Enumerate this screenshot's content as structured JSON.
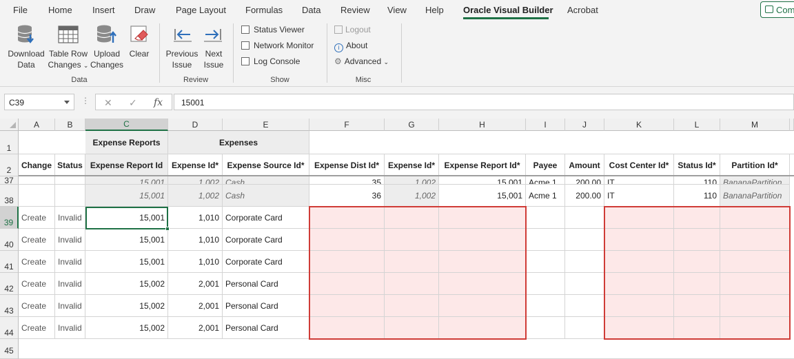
{
  "menu": {
    "items": [
      "File",
      "Home",
      "Insert",
      "Draw",
      "Page Layout",
      "Formulas",
      "Data",
      "Review",
      "View",
      "Help",
      "Oracle Visual Builder",
      "Acrobat"
    ],
    "comments_label": "Com"
  },
  "ribbon": {
    "data_group": {
      "label": "Data",
      "download": [
        "Download",
        "Data"
      ],
      "table_row_changes": [
        "Table Row",
        "Changes"
      ],
      "upload": [
        "Upload",
        "Changes"
      ],
      "clear": "Clear"
    },
    "review_group": {
      "label": "Review",
      "previous": [
        "Previous",
        "Issue"
      ],
      "next": [
        "Next",
        "Issue"
      ]
    },
    "show_group": {
      "label": "Show",
      "status_viewer": "Status Viewer",
      "network_monitor": "Network Monitor",
      "log_console": "Log Console"
    },
    "misc_group": {
      "label": "Misc",
      "logout": "Logout",
      "about": "About",
      "advanced": "Advanced"
    }
  },
  "formula_bar": {
    "name_box": "C39",
    "value": "15001"
  },
  "grid": {
    "columns": [
      "A",
      "B",
      "C",
      "D",
      "E",
      "F",
      "G",
      "H",
      "I",
      "J",
      "K",
      "L",
      "M"
    ],
    "row1": {
      "expense_reports": "Expense Reports",
      "expenses": "Expenses"
    },
    "row2": [
      "Change",
      "Status",
      "Expense Report Id",
      "Expense Id*",
      "Expense Source Id*",
      "Expense Dist Id*",
      "Expense Id*",
      "Expense Report Id*",
      "Payee",
      "Amount",
      "Cost Center Id*",
      "Status Id*",
      "Partition Id*"
    ],
    "row37_partial": [
      "15,001",
      "1,002",
      "Cash",
      "35",
      "1,002",
      "15,001",
      "Acme 1",
      "200.00",
      "IT",
      "110",
      "BananaPartition"
    ],
    "row38": [
      "15,001",
      "1,002",
      "Cash",
      "36",
      "1,002",
      "15,001",
      "Acme 1",
      "200.00",
      "IT",
      "110",
      "BananaPartition"
    ],
    "rows": [
      {
        "num": "39",
        "change": "Create",
        "status": "Invalid",
        "report_id": "15,001",
        "expense_id": "1,010",
        "source": "Corporate Card"
      },
      {
        "num": "40",
        "change": "Create",
        "status": "Invalid",
        "report_id": "15,001",
        "expense_id": "1,010",
        "source": "Corporate Card"
      },
      {
        "num": "41",
        "change": "Create",
        "status": "Invalid",
        "report_id": "15,001",
        "expense_id": "1,010",
        "source": "Corporate Card"
      },
      {
        "num": "42",
        "change": "Create",
        "status": "Invalid",
        "report_id": "15,002",
        "expense_id": "2,001",
        "source": "Personal Card"
      },
      {
        "num": "43",
        "change": "Create",
        "status": "Invalid",
        "report_id": "15,002",
        "expense_id": "2,001",
        "source": "Personal Card"
      },
      {
        "num": "44",
        "change": "Create",
        "status": "Invalid",
        "report_id": "15,002",
        "expense_id": "2,001",
        "source": "Personal Card"
      }
    ],
    "row_numbers": {
      "r1": "1",
      "r2": "2",
      "r37": "37",
      "r38": "38",
      "r45": "45"
    }
  },
  "colors": {
    "accent": "#1e7145",
    "error_border": "#cf3b36",
    "error_fill": "#fde8e8"
  }
}
